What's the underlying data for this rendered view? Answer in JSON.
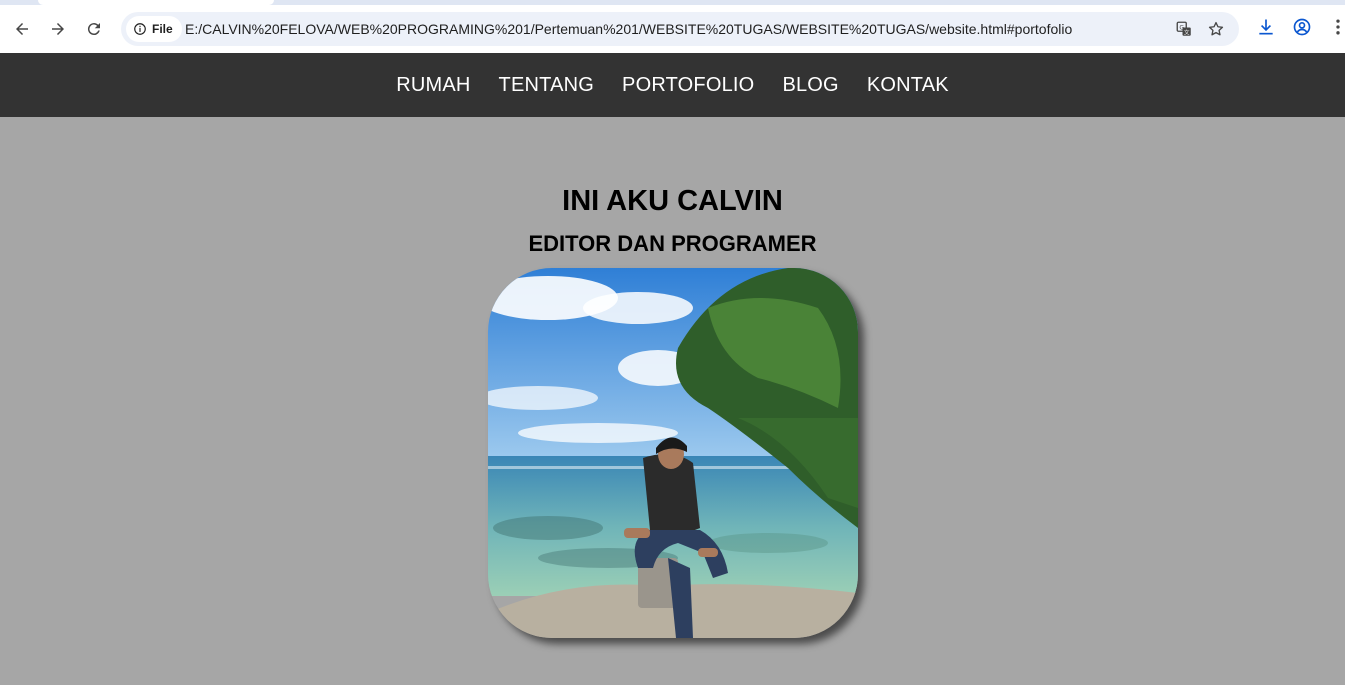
{
  "browser": {
    "site_chip_label": "File",
    "url": "E:/CALVIN%20FELOVA/WEB%20PROGRAMING%201/Pertemuan%201/WEBSITE%20TUGAS/WEBSITE%20TUGAS/website.html#portofolio",
    "icons": [
      "back-arrow-icon",
      "forward-arrow-icon",
      "reload-icon",
      "info-icon",
      "translate-icon",
      "star-icon",
      "download-icon",
      "profile-icon",
      "more-vert-icon"
    ]
  },
  "nav": {
    "items": [
      {
        "label": "RUMAH"
      },
      {
        "label": "TENTANG"
      },
      {
        "label": "PORTOFOLIO"
      },
      {
        "label": "BLOG"
      },
      {
        "label": "KONTAK"
      }
    ]
  },
  "hero": {
    "title": "INI AKU CALVIN",
    "subtitle": "EDITOR DAN PROGRAMER"
  },
  "colors": {
    "page_background": "#a6a6a6",
    "nav_background": "#333333",
    "nav_text": "#ffffff",
    "omnibox_background": "#edf1f9"
  }
}
